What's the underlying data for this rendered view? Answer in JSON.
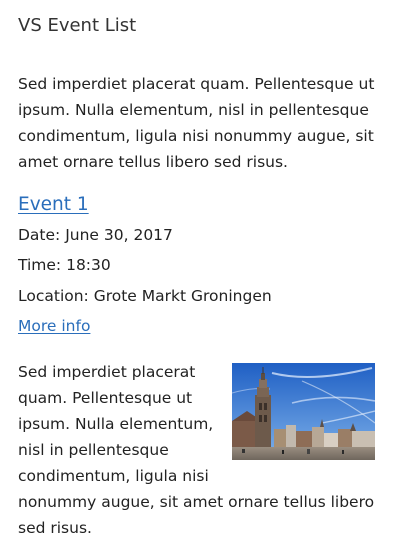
{
  "page": {
    "title": "VS Event List",
    "intro": "Sed imperdiet placerat quam. Pellentesque ut ipsum. Nulla elementum, nisl in pellentesque condimentum, ligula nisi nonummy augue, sit amet ornare tellus libero sed risus."
  },
  "event": {
    "title": "Event 1",
    "date": "Date: June 30, 2017",
    "time": "Time: 18:30",
    "location": "Location: Grote Markt Groningen",
    "more_info": "More info",
    "description": "Sed imperdiet placerat quam. Pellentesque ut ipsum. Nulla elementum, nisl in pellentesque condimentum, ligula nisi nonummy augue, sit amet ornare tellus libero sed risus.",
    "image_subject": "Martinitoren tower and Grote Markt square, Groningen"
  },
  "colors": {
    "link": "#2a6ebb",
    "text": "#222222",
    "title": "#333333",
    "sky": "#2d6fd0"
  }
}
